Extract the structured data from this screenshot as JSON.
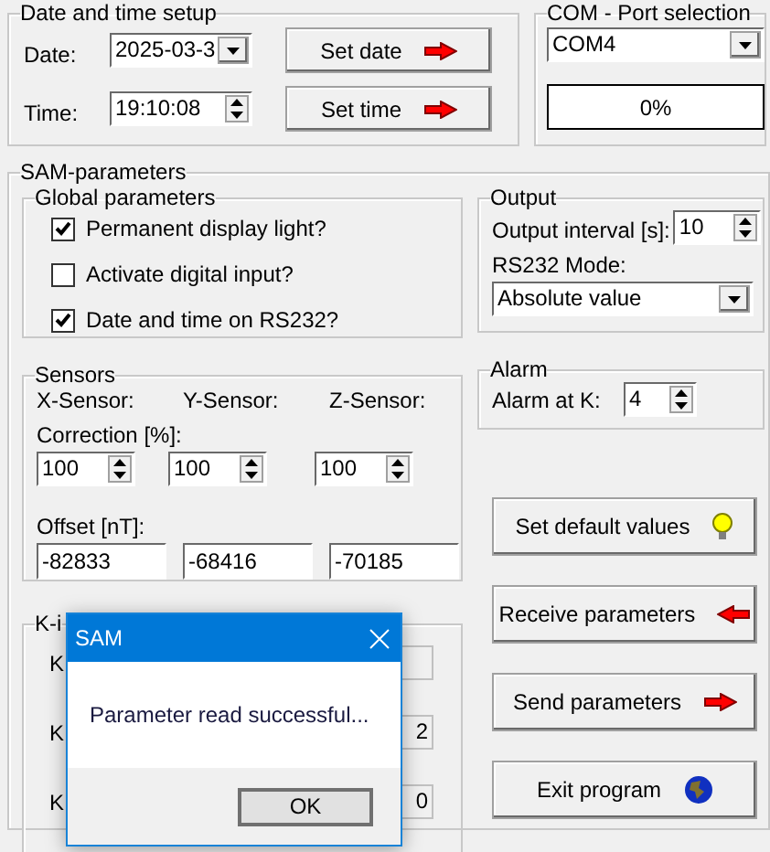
{
  "date_time_setup": {
    "title": "Date and time setup",
    "date_label": "Date:",
    "date_value": "2025-03-3",
    "time_label": "Time:",
    "time_value": "19:10:08",
    "buttons": [
      {
        "label": "Set date",
        "kind": "arrow_right"
      },
      {
        "label": "Set time",
        "kind": "arrow_right"
      }
    ]
  },
  "com_port": {
    "title": "COM - Port selection",
    "port": "COM4",
    "progress_text": "0%",
    "level": 0
  },
  "sam_parameters": {
    "title": "SAM-parameters",
    "global_parameters": {
      "title": "Global parameters",
      "options": [
        {
          "label": "Permanent display light?",
          "checked": true
        },
        {
          "label": "Activate digital input?",
          "checked": false
        },
        {
          "label": "Date and time on RS232?",
          "checked": true
        }
      ]
    },
    "output": {
      "title": "Output",
      "interval_label": "Output interval [s]:",
      "interval_value": "10",
      "mode_label": "RS232 Mode:",
      "mode_value": "Absolute value"
    },
    "sensors": {
      "title": "Sensors",
      "columns": [
        "X-Sensor:",
        "Y-Sensor:",
        "Z-Sensor:"
      ],
      "correction_label": "Correction [%]:",
      "corrections": [
        "100",
        "100",
        "100"
      ],
      "offset_label": "Offset [nT]:",
      "offsets": [
        "-82833",
        "-68416",
        "-70185"
      ]
    },
    "alarm": {
      "title": "Alarm",
      "label": "Alarm at K:",
      "value": "4"
    },
    "k_group": {
      "title": "K-i",
      "rows": [
        {
          "label": "K"
        },
        {
          "label": "K",
          "value": "2"
        },
        {
          "label": "K",
          "value": "0"
        }
      ]
    },
    "buttons": [
      {
        "label": "Set default values",
        "kind": "bulb"
      },
      {
        "label": "Receive parameters",
        "kind": "arrow_left"
      },
      {
        "label": "Send parameters",
        "kind": "arrow_right"
      },
      {
        "label": "Exit program",
        "kind": "globe"
      }
    ]
  },
  "dialog": {
    "title": "SAM",
    "message": "Parameter read successful...",
    "ok_button": "OK"
  }
}
